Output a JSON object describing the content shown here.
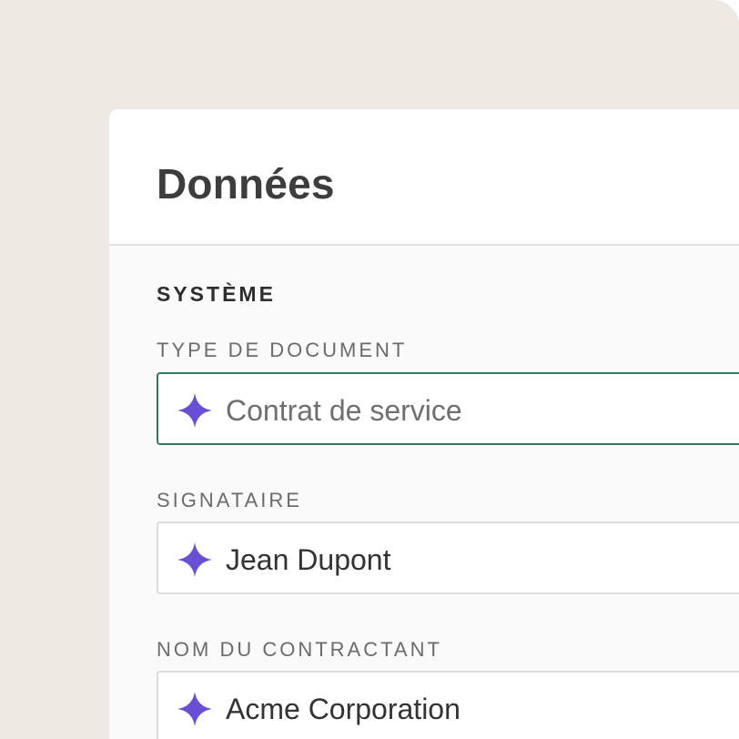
{
  "panel": {
    "title": "Données"
  },
  "section": {
    "heading": "SYSTÈME"
  },
  "fields": [
    {
      "label": "TYPE DE DOCUMENT",
      "value": "Contrat de service",
      "active": true,
      "icon": "sparkle-icon"
    },
    {
      "label": "SIGNATAIRE",
      "value": "Jean Dupont",
      "active": false,
      "icon": "sparkle-icon"
    },
    {
      "label": "NOM DU CONTRACTANT",
      "value": "Acme Corporation",
      "active": false,
      "icon": "sparkle-icon"
    }
  ],
  "colors": {
    "backdrop": "#eeeae3",
    "sparkle": "#6a4fd6",
    "active_border": "#2f7a5f"
  }
}
